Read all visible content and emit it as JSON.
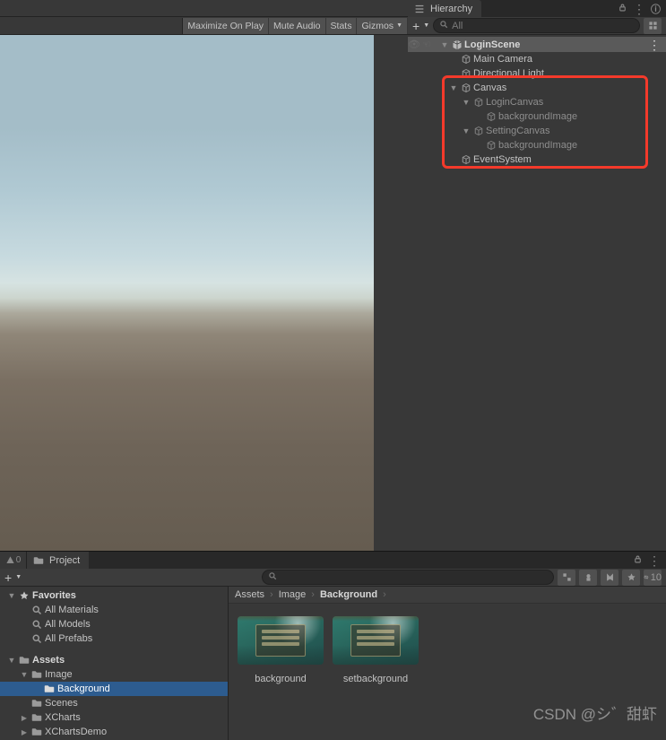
{
  "gameToolbar": {
    "maximize": "Maximize On Play",
    "mute": "Mute Audio",
    "stats": "Stats",
    "gizmos": "Gizmos"
  },
  "hierarchy": {
    "tab": "Hierarchy",
    "searchPlaceholder": "All",
    "scene": "LoginScene",
    "items": [
      {
        "name": "Main Camera",
        "depth": 1
      },
      {
        "name": "Directional Light",
        "depth": 1
      },
      {
        "name": "Canvas",
        "depth": 1,
        "fold": true
      },
      {
        "name": "LoginCanvas",
        "depth": 2,
        "fold": true
      },
      {
        "name": "backgroundImage",
        "depth": 3
      },
      {
        "name": "SettingCanvas",
        "depth": 2,
        "fold": true
      },
      {
        "name": "backgroundImage",
        "depth": 3
      },
      {
        "name": "EventSystem",
        "depth": 1
      }
    ]
  },
  "project": {
    "tab": "Project",
    "warnCount": "0",
    "hiddenCount": "10",
    "favorites": {
      "label": "Favorites",
      "items": [
        "All Materials",
        "All Models",
        "All Prefabs"
      ]
    },
    "assets": {
      "label": "Assets",
      "tree": [
        {
          "name": "Image",
          "depth": 1,
          "fold": true
        },
        {
          "name": "Background",
          "depth": 2,
          "selected": true
        },
        {
          "name": "Scenes",
          "depth": 1
        },
        {
          "name": "XCharts",
          "depth": 1,
          "foldRight": true
        },
        {
          "name": "XChartsDemo",
          "depth": 1,
          "foldRight": true
        }
      ]
    },
    "breadcrumb": [
      "Assets",
      "Image",
      "Background"
    ],
    "thumbs": [
      "background",
      "setbackground"
    ]
  },
  "watermark": "CSDN @シ゛甜虾"
}
